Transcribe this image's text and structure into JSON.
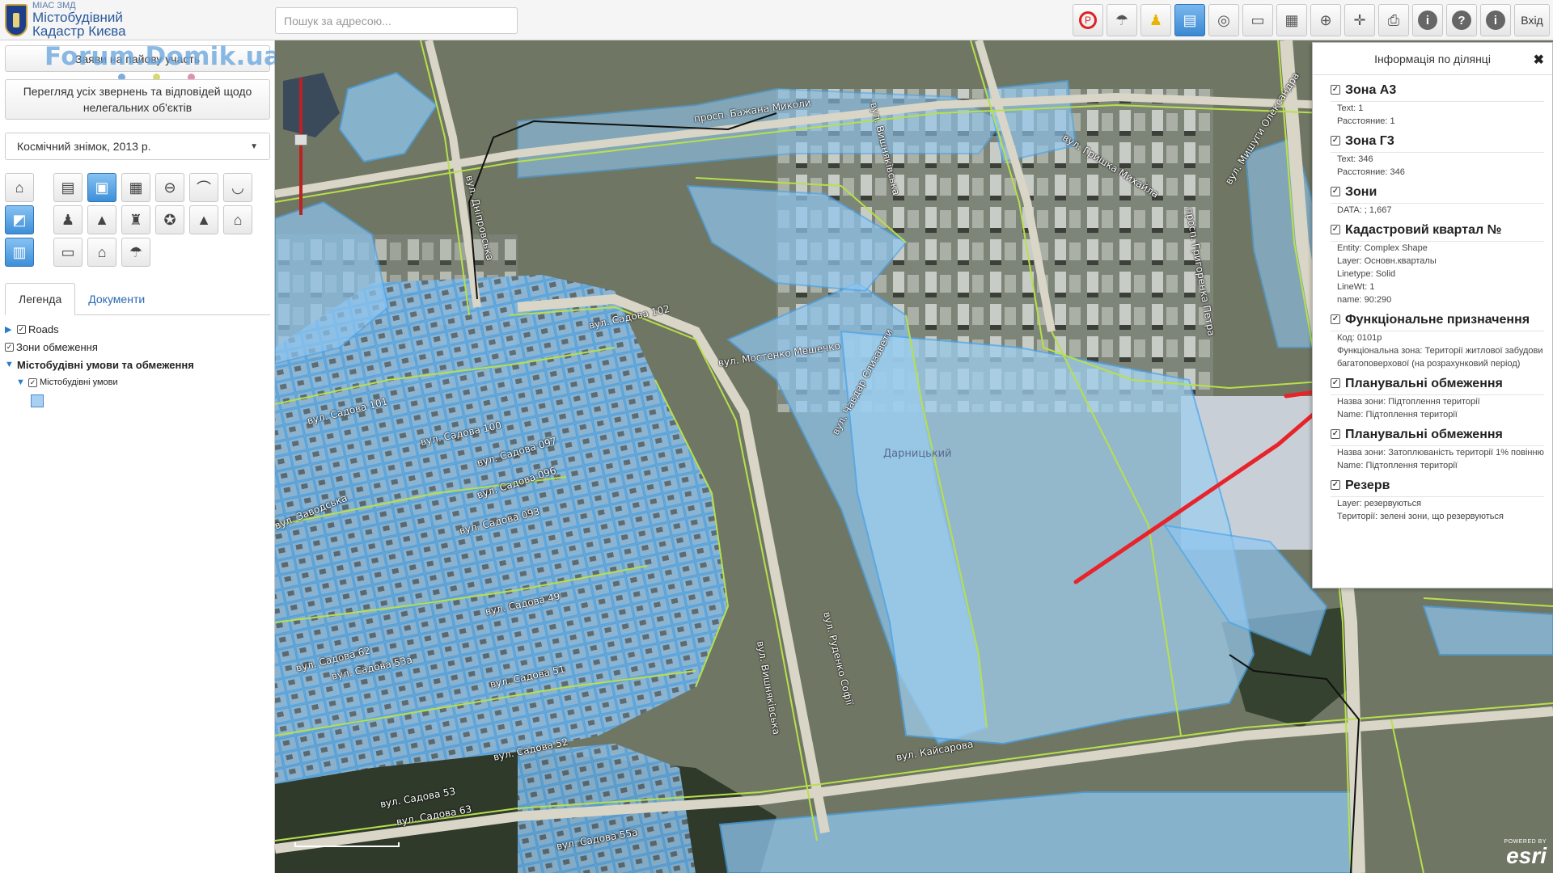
{
  "header": {
    "logo_small": "МІАС ЗМД",
    "logo_line1": "Містобудівний",
    "logo_line2": "Кадастр Києва",
    "search_placeholder": "Пошук за адресою...",
    "login_label": "Вхід",
    "toolbar_icons": [
      "no-parking-icon",
      "umbrella-icon",
      "person-icon",
      "clipboard-icon",
      "compass-icon",
      "ruler-icon",
      "table-icon",
      "globe-icon",
      "crosshair-icon",
      "print-icon",
      "info-icon",
      "help-icon",
      "about-icon"
    ]
  },
  "left_panel": {
    "watermark": "Forum.Domik.ua",
    "participate_label": "Заяви на пайову участь",
    "view_all_label": "Перегляд усіх звернень та відповідей щодо нелегальних об'єктів",
    "basemap_selected": "Космічний знімок, 2013 р.",
    "tabs": [
      "Легенда",
      "Документи"
    ],
    "legend": {
      "roads": "Roads",
      "zones": "Зони обмеження",
      "conditions": "Містобудівні умови та обмеження",
      "conditions_sub": "Містобудівні умови"
    }
  },
  "map": {
    "district_label": "Дарницький",
    "streets": [
      "просп. Бажана Миколи",
      "вул. Дніпровська",
      "вул. Вишняківська",
      "вул. Гришка Михайла",
      "просп. Григоренка Петра",
      "вул. Мишуги Олександра",
      "вул. Садова 102",
      "вул. Садова 101",
      "вул. Садова 100",
      "вул. Садова 097",
      "вул. Садова 096",
      "вул. Садова 093",
      "вул. Садова 49",
      "вул. Садова 52",
      "вул. Садова 53",
      "вул. Садова 53а",
      "вул. Садова 51",
      "вул. Садова 62",
      "вул. Садова 63",
      "вул. Садова 55а",
      "вул. Заводська",
      "вул. Мостенко Мешечко",
      "вул. Чавдар Єлизавети",
      "вул. Руденко Софії",
      "вул. Вишняківська",
      "вул. Кайсарова"
    ],
    "esri_powered": "POWERED BY",
    "esri_text": "esri",
    "colors": {
      "parcel_fill": "#8fc6f0",
      "parcel_stroke": "#4aa6ee",
      "boundary": "#b8e04a",
      "arrow": "#e8232a"
    }
  },
  "info_panel": {
    "title": "Інформація по ділянці",
    "sections": [
      {
        "title": "Зона А3",
        "attrs": [
          "Text: 1",
          "Расстояние: 1"
        ]
      },
      {
        "title": "Зона Г3",
        "attrs": [
          "Text: 346",
          "Расстояние: 346"
        ]
      },
      {
        "title": "Зони",
        "attrs": [
          "DATA: ; 1,667"
        ]
      },
      {
        "title": "Кадастровий квартал №",
        "attrs": [
          "Entity: Complex Shape",
          "Layer: Основн.кварталы",
          "Linetype: Solid",
          "LineWt: 1",
          "name: 90:290"
        ]
      },
      {
        "title": "Функціональне призначення",
        "attrs": [
          "Код: 0101р",
          "Функціональна зона: Території житлової забудови багатоповерхової (на розрахунковий період)"
        ]
      },
      {
        "title": "Планувальні обмеження",
        "attrs": [
          "Назва зони: Підтоплення території",
          "Name: Підтоплення території"
        ]
      },
      {
        "title": "Планувальні обмеження",
        "attrs": [
          "Назва зони: Затоплюваність території 1% повінню",
          "Name: Підтоплення території"
        ]
      },
      {
        "title": "Резерв",
        "attrs": [
          "Layer: резервуються",
          "Території: зелені зони, що резервуються"
        ]
      }
    ]
  }
}
